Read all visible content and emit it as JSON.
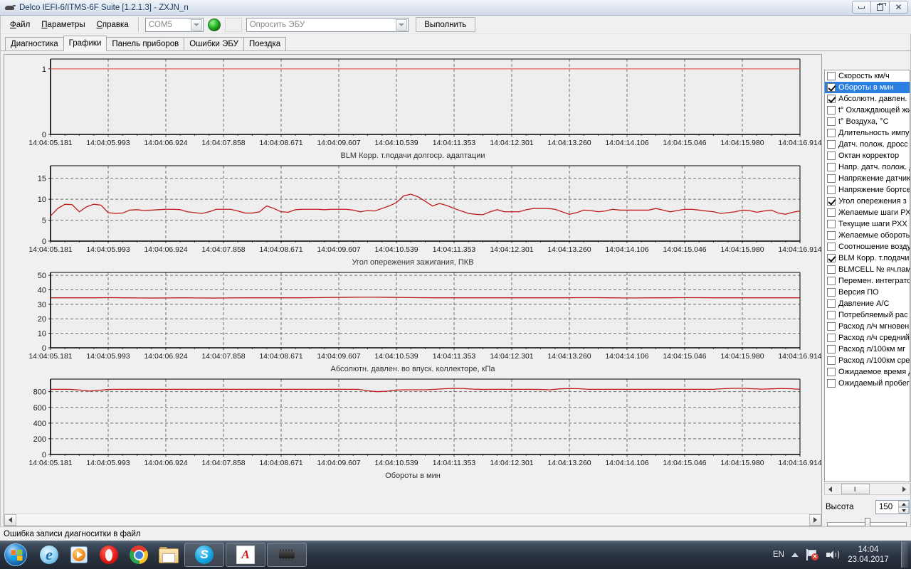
{
  "window": {
    "title": "Delco IEFI-6/ITMS-6F Suite [1.2.1.3] - ZXJN_n",
    "app_icon": "mouse-icon",
    "minimize_label": "–",
    "maximize_label": "▣",
    "close_label": "✕"
  },
  "menu": [
    {
      "label": "Файл"
    },
    {
      "label": "Параметры"
    },
    {
      "label": "Справка"
    }
  ],
  "toolbar": {
    "port_value": "COM5",
    "command_value": "Опросить ЭБУ",
    "execute_label": "Выполнить",
    "led_state": "connected-green"
  },
  "tabs": [
    {
      "label": "Диагностика",
      "active": false
    },
    {
      "label": "Графики",
      "active": true
    },
    {
      "label": "Панель приборов",
      "active": false
    },
    {
      "label": "Ошибки ЭБУ",
      "active": false
    },
    {
      "label": "Поездка",
      "active": false
    }
  ],
  "x_tick_labels": [
    "14:04:05.181",
    "14:04:05.993",
    "14:04:06.924",
    "14:04:07.858",
    "14:04:08.671",
    "14:04:09.607",
    "14:04:10.539",
    "14:04:11.353",
    "14:04:12.301",
    "14:04:13.260",
    "14:04:14.106",
    "14:04:15.046",
    "14:04:15.980",
    "14:04:16.914"
  ],
  "chart_data": [
    {
      "type": "line",
      "title": "BLM Корр. т.подачи долгоср. адаптации",
      "xlabel": "",
      "ylabel": "",
      "ylim": [
        0,
        1.15
      ],
      "yticks": [
        0,
        1
      ],
      "ytick_labels": [
        "0",
        "1"
      ],
      "grid": true,
      "color": "#e8736a",
      "x": [
        "14:04:05.181",
        "14:04:05.993",
        "14:04:06.924",
        "14:04:07.858",
        "14:04:08.671",
        "14:04:09.607",
        "14:04:10.539",
        "14:04:11.353",
        "14:04:12.301",
        "14:04:13.260",
        "14:04:14.106",
        "14:04:15.046",
        "14:04:15.980",
        "14:04:16.914"
      ],
      "values": [
        1,
        1,
        1,
        1,
        1,
        1,
        1,
        1,
        1,
        1,
        1,
        1,
        1,
        1
      ]
    },
    {
      "type": "line",
      "title": "Угол опережения зажигания, ПКВ",
      "xlabel": "",
      "ylabel": "",
      "ylim": [
        0,
        18
      ],
      "yticks": [
        0,
        5,
        10,
        15
      ],
      "ytick_labels": [
        "0",
        "5",
        "10",
        "15"
      ],
      "grid": true,
      "color": "#c01a1a",
      "values": [
        6.0,
        7.8,
        8.8,
        8.7,
        7.0,
        8.2,
        8.8,
        8.6,
        6.8,
        6.6,
        6.7,
        7.4,
        7.5,
        7.3,
        7.4,
        7.5,
        7.6,
        7.6,
        7.5,
        7.0,
        6.8,
        6.6,
        7.0,
        7.6,
        7.6,
        7.6,
        7.2,
        6.7,
        6.7,
        7.0,
        8.4,
        7.8,
        7.0,
        6.9,
        7.5,
        7.6,
        7.6,
        7.6,
        7.5,
        7.6,
        7.6,
        7.6,
        7.4,
        7.0,
        7.3,
        7.2,
        7.8,
        8.4,
        9.2,
        10.8,
        11.2,
        10.6,
        9.5,
        8.4,
        9.0,
        8.5,
        7.8,
        7.2,
        6.6,
        6.4,
        6.3,
        7.0,
        7.5,
        7.0,
        7.0,
        7.0,
        7.5,
        7.8,
        7.8,
        7.8,
        7.6,
        7.0,
        6.4,
        6.8,
        7.4,
        7.3,
        7.0,
        7.2,
        7.6,
        7.4,
        7.4,
        7.4,
        7.4,
        7.4,
        7.8,
        7.4,
        7.0,
        7.3,
        7.6,
        7.6,
        7.4,
        7.2,
        7.0,
        6.6,
        6.8,
        7.0,
        7.4,
        7.3,
        6.9,
        7.2,
        7.4,
        6.7,
        6.4,
        6.9,
        7.2
      ]
    },
    {
      "type": "line",
      "title": "Абсолютн. давлен. во впуск. коллекторе, кПа",
      "xlabel": "",
      "ylabel": "",
      "ylim": [
        0,
        52
      ],
      "yticks": [
        0,
        10,
        20,
        30,
        40,
        50
      ],
      "ytick_labels": [
        "0",
        "10",
        "20",
        "30",
        "40",
        "50"
      ],
      "grid": true,
      "color": "#b81c1c",
      "values": [
        34.5,
        34.5,
        34.5,
        34.5,
        34.6,
        34.5,
        34.4,
        34.3,
        34.4,
        34.5,
        34.4,
        34.3,
        34.4,
        34.5,
        34.5,
        34.5,
        34.5,
        34.5,
        34.6,
        34.7,
        34.8,
        34.9,
        34.9,
        34.8,
        34.7,
        34.6,
        34.5,
        34.5,
        34.5,
        34.5,
        34.5,
        34.5,
        34.5,
        34.5,
        34.5,
        34.5,
        34.6,
        34.6,
        34.5,
        34.4,
        34.4,
        34.5,
        34.5,
        34.6,
        34.6,
        34.5,
        34.5,
        34.5,
        34.5,
        34.5,
        34.5,
        34.5
      ]
    },
    {
      "type": "line",
      "title": "Обороты в мин",
      "xlabel": "",
      "ylabel": "",
      "ylim": [
        0,
        960
      ],
      "yticks": [
        0,
        200,
        400,
        600,
        800
      ],
      "ytick_labels": [
        "0",
        "200",
        "400",
        "600",
        "800"
      ],
      "grid": true,
      "color": "#c01a1a",
      "values": [
        830,
        830,
        830,
        822,
        808,
        816,
        828,
        830,
        830,
        830,
        830,
        830,
        830,
        830,
        830,
        830,
        830,
        830,
        830,
        830,
        830,
        830,
        830,
        830,
        830,
        830,
        830,
        830,
        830,
        830,
        830,
        830,
        830,
        812,
        800,
        806,
        820,
        824,
        824,
        824,
        830,
        838,
        842,
        840,
        832,
        828,
        830,
        830,
        830,
        830,
        830,
        828,
        824,
        836,
        840,
        838,
        830,
        830,
        830,
        830,
        830,
        830,
        830,
        830,
        830,
        830,
        830,
        830,
        830,
        830,
        838,
        842,
        842,
        838,
        832,
        836,
        840,
        838,
        830
      ]
    }
  ],
  "sidebar": {
    "height_label": "Высота",
    "height_value": "150",
    "scroll_thumb_glyph": "‖",
    "items": [
      {
        "label": "Скорость км/ч",
        "checked": false,
        "selected": false
      },
      {
        "label": "Обороты в мин",
        "checked": true,
        "selected": true
      },
      {
        "label": "Абсолютн. давлен. в",
        "checked": true,
        "selected": false
      },
      {
        "label": "t° Охлаждающей жи",
        "checked": false,
        "selected": false
      },
      {
        "label": "t° Воздуха, °C",
        "checked": false,
        "selected": false
      },
      {
        "label": "Длительность импу",
        "checked": false,
        "selected": false
      },
      {
        "label": "Датч. полож. дросс",
        "checked": false,
        "selected": false
      },
      {
        "label": "Октан корректор",
        "checked": false,
        "selected": false
      },
      {
        "label": "Напр. датч. полож. д",
        "checked": false,
        "selected": false
      },
      {
        "label": "Напряжение датчик",
        "checked": false,
        "selected": false
      },
      {
        "label": "Напряжение бортсе",
        "checked": false,
        "selected": false
      },
      {
        "label": "Угол опережения з",
        "checked": true,
        "selected": false
      },
      {
        "label": "Желаемые шаги РХ",
        "checked": false,
        "selected": false
      },
      {
        "label": "Текущие шаги РХХ",
        "checked": false,
        "selected": false
      },
      {
        "label": "Желаемые обороты",
        "checked": false,
        "selected": false
      },
      {
        "label": "Соотношение возду",
        "checked": false,
        "selected": false
      },
      {
        "label": "BLM Корр. т.подачи",
        "checked": true,
        "selected": false
      },
      {
        "label": "BLMCELL № яч.пам",
        "checked": false,
        "selected": false
      },
      {
        "label": "Перемен. интеграто",
        "checked": false,
        "selected": false
      },
      {
        "label": "Версия ПО",
        "checked": false,
        "selected": false
      },
      {
        "label": "Давление А/С",
        "checked": false,
        "selected": false
      },
      {
        "label": "Потребляемый рас",
        "checked": false,
        "selected": false
      },
      {
        "label": "Расход л/ч мгновен",
        "checked": false,
        "selected": false
      },
      {
        "label": "Расход л/ч средний",
        "checked": false,
        "selected": false
      },
      {
        "label": "Расход л/100км мг",
        "checked": false,
        "selected": false
      },
      {
        "label": "Расход л/100км сре",
        "checked": false,
        "selected": false
      },
      {
        "label": "Ожидаемое время д",
        "checked": false,
        "selected": false
      },
      {
        "label": "Ожидаемый пробег",
        "checked": false,
        "selected": false
      }
    ]
  },
  "statusbar": {
    "message": "Ошибка записи диагноситки в файл"
  },
  "taskbar": {
    "start_label": "start-orb",
    "apps": [
      {
        "name": "internet-explorer",
        "glyph": "e",
        "boxed": false
      },
      {
        "name": "windows-media-player",
        "glyph": "",
        "boxed": false
      },
      {
        "name": "opera",
        "glyph": "",
        "boxed": false
      },
      {
        "name": "google-chrome",
        "glyph": "",
        "boxed": false
      },
      {
        "name": "file-explorer",
        "glyph": "",
        "boxed": false
      },
      {
        "name": "skype",
        "glyph": "S",
        "boxed": true
      },
      {
        "name": "ac-diagnostics",
        "glyph": "A",
        "boxed": true
      },
      {
        "name": "chip-tool",
        "glyph": "",
        "boxed": true
      }
    ],
    "tray": {
      "language": "EN",
      "time": "14:04",
      "date": "23.04.2017"
    }
  }
}
